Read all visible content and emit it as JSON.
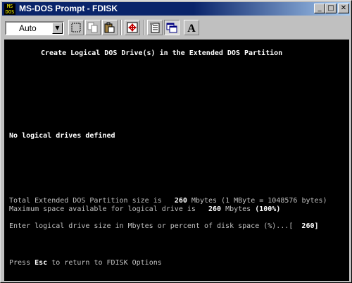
{
  "window": {
    "title": "MS-DOS Prompt - FDISK",
    "icon_text": "MS\nDOS",
    "controls": {
      "minimize": "_",
      "maximize": "□",
      "close": "✕"
    }
  },
  "toolbar": {
    "font_size": "Auto",
    "tools": [
      "mark-icon",
      "copy-icon",
      "paste-icon",
      "fullscreen-icon",
      "properties-icon",
      "background-icon",
      "font-icon"
    ],
    "font_button_label": "A"
  },
  "console": {
    "heading": "Create Logical DOS Drive(s) in the Extended DOS Partition",
    "no_drives": "No logical drives defined",
    "total_label": "Total Extended DOS Partition size is",
    "total_value": "260",
    "total_suffix": "Mbytes (1 MByte = 1048576 bytes)",
    "max_label": "Maximum space available for logical drive is",
    "max_value": "260",
    "max_suffix": "Mbytes",
    "max_percent": "(100%)",
    "prompt": "Enter logical drive size in Mbytes or percent of disk space (%)...[",
    "prompt_value": "260]",
    "press_prefix": "Press",
    "press_key": "Esc",
    "press_suffix": "to return to FDISK Options"
  }
}
